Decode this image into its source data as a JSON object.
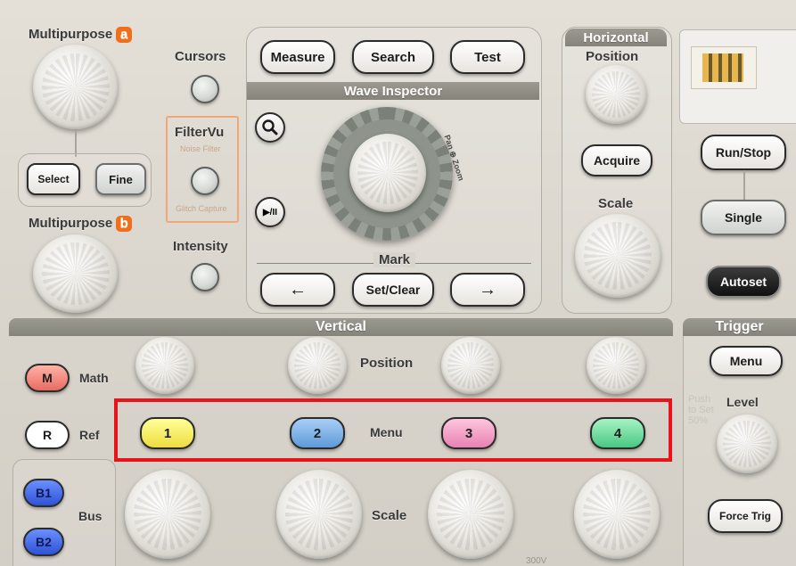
{
  "left": {
    "multipurpose_a": "Multipurpose",
    "badge_a": "a",
    "multipurpose_b": "Multipurpose",
    "badge_b": "b",
    "select": "Select",
    "fine": "Fine",
    "cursors": "Cursors",
    "filtervu": "FilterVu",
    "noise_filter": "Noise Filter",
    "glitch_capture": "Glitch Capture",
    "intensity": "Intensity"
  },
  "center": {
    "measure": "Measure",
    "search": "Search",
    "test": "Test",
    "wave_inspector": "Wave Inspector",
    "pan_zoom": "Pan ⊕ Zoom",
    "play_pause": "▶/II",
    "mark": "Mark",
    "set_clear": "Set/Clear",
    "left_arrow": "←",
    "right_arrow": "→"
  },
  "horizontal": {
    "title": "Horizontal",
    "position": "Position",
    "acquire": "Acquire",
    "scale": "Scale"
  },
  "run": {
    "run_stop": "Run/Stop",
    "single": "Single",
    "autoset": "Autoset"
  },
  "vertical": {
    "title": "Vertical",
    "position": "Position",
    "menu": "Menu",
    "scale": "Scale",
    "math_key": "M",
    "math": "Math",
    "ref_key": "R",
    "ref": "Ref",
    "b1": "B1",
    "b2": "B2",
    "bus": "Bus",
    "ch1": "1",
    "ch2": "2",
    "ch3": "3",
    "ch4": "4",
    "bottom_faint": "300V"
  },
  "trigger": {
    "title": "Trigger",
    "menu": "Menu",
    "level": "Level",
    "push_to_set": "Push to Set 50%",
    "force_trig": "Force Trig"
  },
  "highlight": {
    "color": "#e8141b"
  }
}
